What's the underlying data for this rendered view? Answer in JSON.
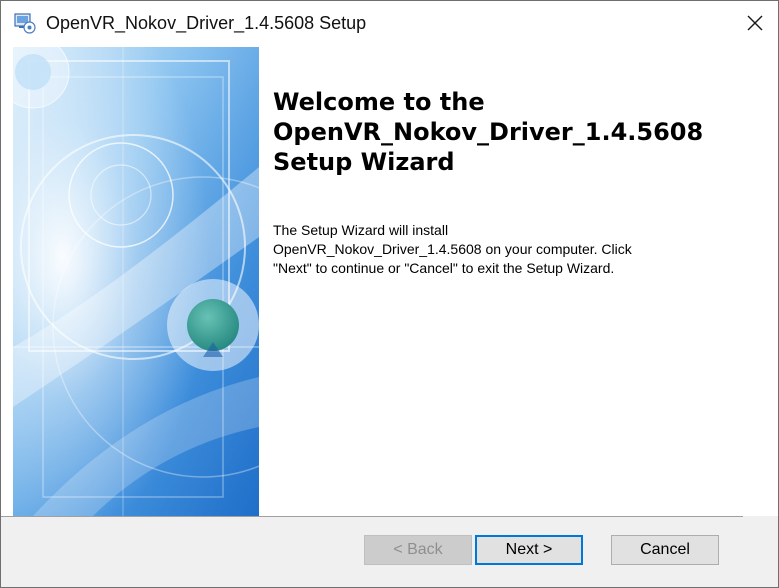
{
  "window": {
    "title": "OpenVR_Nokov_Driver_1.4.5608 Setup"
  },
  "icons": {
    "app": "installer-icon",
    "close": "close-icon",
    "banner": "wizard-banner-image"
  },
  "main": {
    "heading_lines": [
      "Welcome to the",
      "OpenVR_Nokov_Driver_1.4.5608",
      "Setup Wizard"
    ],
    "body_lines": [
      "The Setup Wizard will install",
      "OpenVR_Nokov_Driver_1.4.5608 on your computer.  Click",
      "\"Next\" to continue or \"Cancel\" to exit the Setup Wizard."
    ]
  },
  "buttons": {
    "back_label": "< Back",
    "next_label": "Next >",
    "cancel_label": "Cancel",
    "back_enabled": false
  },
  "colors": {
    "accent": "#0078d7",
    "banner_blue": "#5aa8e6",
    "banner_teal": "#3aa59a"
  }
}
